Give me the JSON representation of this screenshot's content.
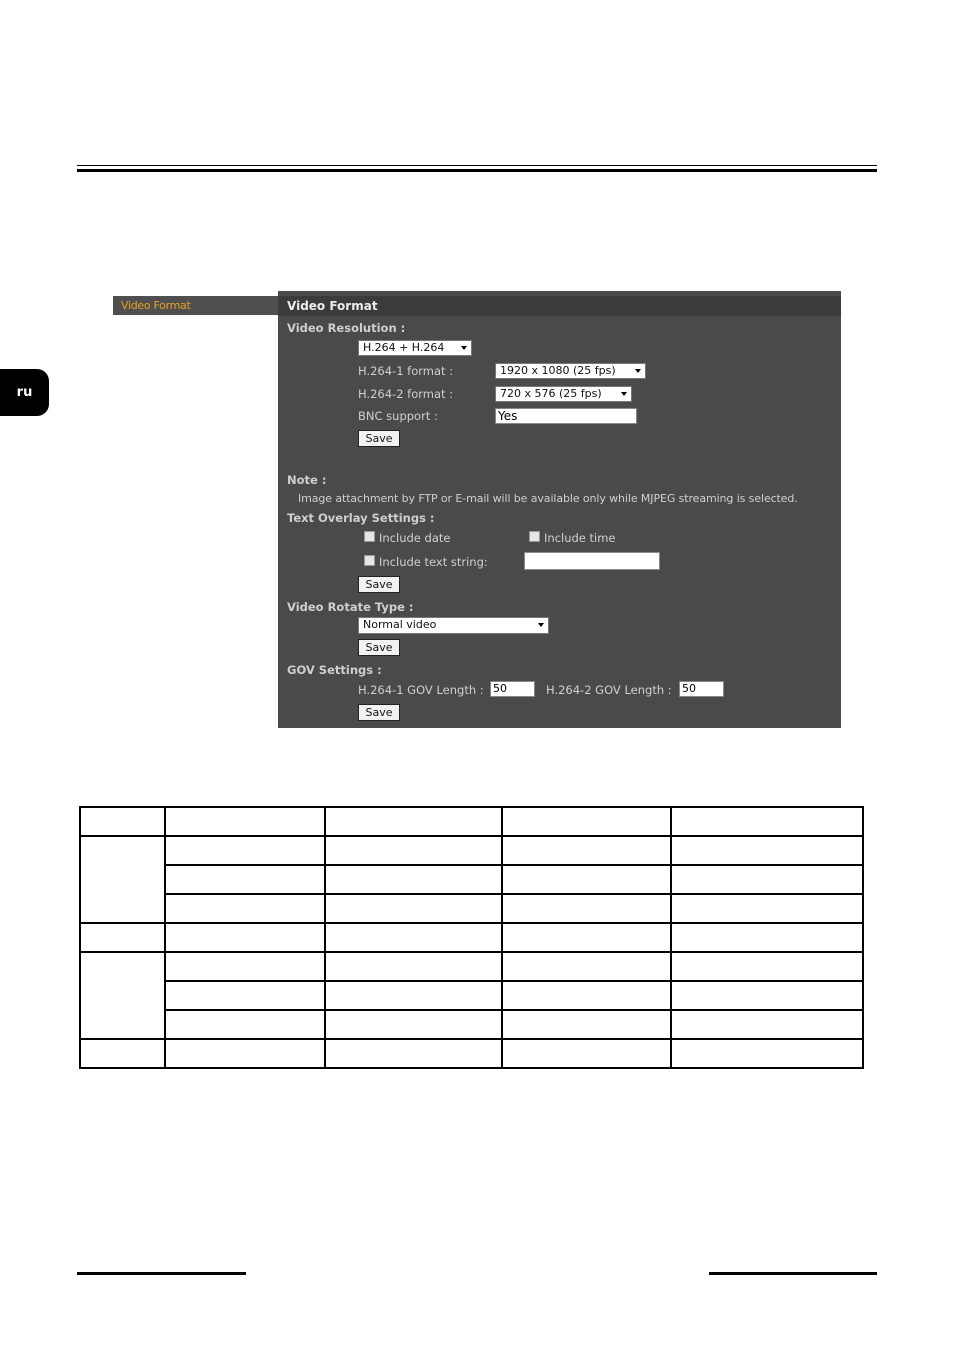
{
  "language_tab": "ru",
  "sidebar": {
    "active_item": "Video Format"
  },
  "panel": {
    "title": "Video Format",
    "video_resolution": {
      "heading": "Video Resolution :",
      "mode_value": "H.264 + H.264",
      "h264_1_label": "H.264-1 format :",
      "h264_1_value": "1920 x 1080 (25 fps)",
      "h264_2_label": "H.264-2 format :",
      "h264_2_value": "720 x 576 (25 fps)",
      "bnc_label": "BNC support :",
      "bnc_value": "Yes",
      "save_label": "Save"
    },
    "note": {
      "heading": "Note :",
      "text": "Image attachment by FTP or E-mail will be available only while MJPEG streaming is selected."
    },
    "text_overlay": {
      "heading": "Text Overlay Settings :",
      "include_date_label": "Include date",
      "include_date_checked": false,
      "include_time_label": "Include time",
      "include_time_checked": false,
      "include_text_label": "Include text string:",
      "include_text_checked": false,
      "text_value": "",
      "save_label": "Save"
    },
    "video_rotate": {
      "heading": "Video Rotate Type :",
      "value": "Normal video",
      "save_label": "Save"
    },
    "gov": {
      "heading": "GOV Settings :",
      "h264_1_label": "H.264-1 GOV Length :",
      "h264_1_value": "50",
      "h264_2_label": "H.264-2 GOV Length :",
      "h264_2_value": "50",
      "save_label": "Save"
    }
  }
}
